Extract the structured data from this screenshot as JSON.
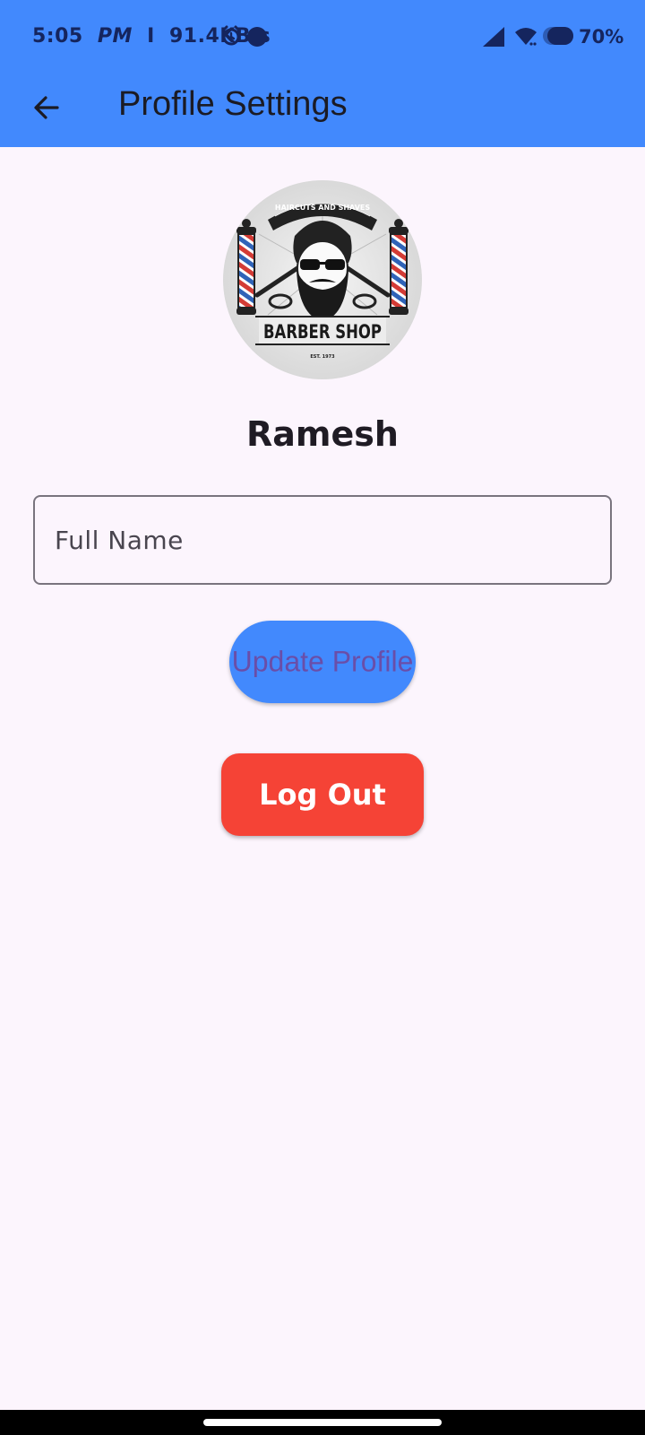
{
  "status_bar": {
    "time": "5:05",
    "period": "PM",
    "separator": "I",
    "network_speed": "91.4KB/s",
    "battery_percent": "70%",
    "icons": [
      "alarm-icon",
      "dot-icon",
      "signal-icon",
      "wifi-icon",
      "battery-icon"
    ]
  },
  "app_bar": {
    "back_icon": "arrow-left-icon",
    "title": "Profile Settings"
  },
  "profile": {
    "avatar": {
      "banner_text": "HAIRCUTS AND SHAVES",
      "logo_text": "BARBER SHOP",
      "est_text": "EST. 1973"
    },
    "name": "Ramesh"
  },
  "form": {
    "full_name": {
      "placeholder": "Full Name",
      "value": ""
    }
  },
  "buttons": {
    "update_label": "Update Profile",
    "logout_label": "Log Out"
  },
  "colors": {
    "primary": "#4289fd",
    "danger": "#f54336",
    "background": "#fcf5fd",
    "update_text": "#6a4ea8"
  }
}
